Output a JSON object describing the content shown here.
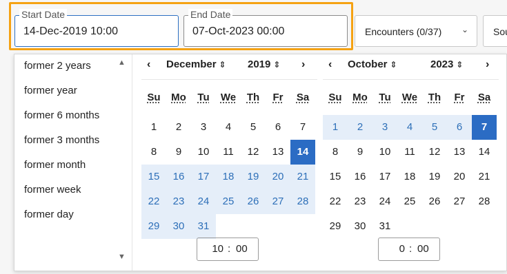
{
  "start_date": {
    "legend": "Start Date",
    "value": "14-Dec-2019 10:00"
  },
  "end_date": {
    "legend": "End Date",
    "value": "07-Oct-2023 00:00"
  },
  "encounters_button": {
    "label": "Encounters (0/37)",
    "chevron": "⌄"
  },
  "next_button": {
    "label": "Sou"
  },
  "presets": [
    "former 2 years",
    "former year",
    "former 6 months",
    "former 3 months",
    "former month",
    "former week",
    "former day"
  ],
  "weekday_headers": [
    "Su",
    "Mo",
    "Tu",
    "We",
    "Th",
    "Fr",
    "Sa"
  ],
  "left_calendar": {
    "month": "December",
    "year": "2019",
    "time_hours": "10",
    "time_minutes": "00",
    "weeks": [
      [
        "1",
        "2",
        "3",
        "4",
        "5",
        "6",
        "7"
      ],
      [
        "8",
        "9",
        "10",
        "11",
        "12",
        "13",
        "14"
      ],
      [
        "15",
        "16",
        "17",
        "18",
        "19",
        "20",
        "21"
      ],
      [
        "22",
        "23",
        "24",
        "25",
        "26",
        "27",
        "28"
      ],
      [
        "29",
        "30",
        "31",
        "",
        "",
        "",
        ""
      ]
    ],
    "selected": "14",
    "range_days": [
      "15",
      "16",
      "17",
      "18",
      "19",
      "20",
      "21",
      "22",
      "23",
      "24",
      "25",
      "26",
      "27",
      "28",
      "29",
      "30",
      "31"
    ]
  },
  "right_calendar": {
    "month": "October",
    "year": "2023",
    "time_hours": "0",
    "time_minutes": "00",
    "weeks": [
      [
        "1",
        "2",
        "3",
        "4",
        "5",
        "6",
        "7"
      ],
      [
        "8",
        "9",
        "10",
        "11",
        "12",
        "13",
        "14"
      ],
      [
        "15",
        "16",
        "17",
        "18",
        "19",
        "20",
        "21"
      ],
      [
        "22",
        "23",
        "24",
        "25",
        "26",
        "27",
        "28"
      ],
      [
        "29",
        "30",
        "31",
        "",
        "",
        "",
        ""
      ]
    ],
    "selected": "7",
    "range_days": [
      "1",
      "2",
      "3",
      "4",
      "5",
      "6"
    ]
  },
  "icons": {
    "prev": "‹",
    "next": "›",
    "updown": "⇕",
    "scroll_up": "▲",
    "scroll_down": "▼"
  },
  "colors": {
    "highlight": "#f5a213",
    "selected": "#2b6cc4",
    "range_bg": "#e5eef9",
    "range_text": "#2d6fb8"
  }
}
